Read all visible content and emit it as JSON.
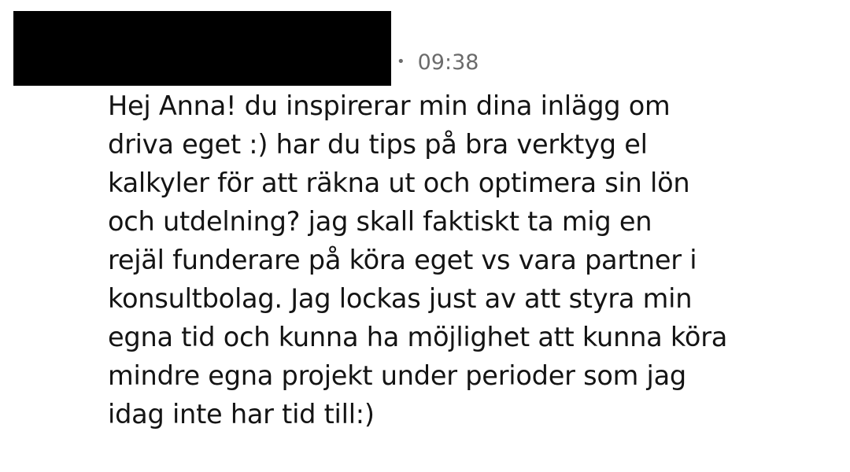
{
  "message": {
    "separator": "•",
    "time": "09:38",
    "lines": [
      "Hej Anna! du inspirerar min dina inlägg om",
      "driva eget :) har du tips på bra verktyg el",
      "kalkyler för att räkna ut och optimera sin lön",
      "och utdelning? jag skall faktiskt ta mig en",
      "rejäl funderare på köra eget vs vara partner i",
      "konsultbolag. Jag lockas just av att styra min",
      "egna tid och kunna ha möjlighet att kunna köra",
      "mindre egna projekt under perioder som jag",
      "idag inte har tid till:)"
    ]
  }
}
